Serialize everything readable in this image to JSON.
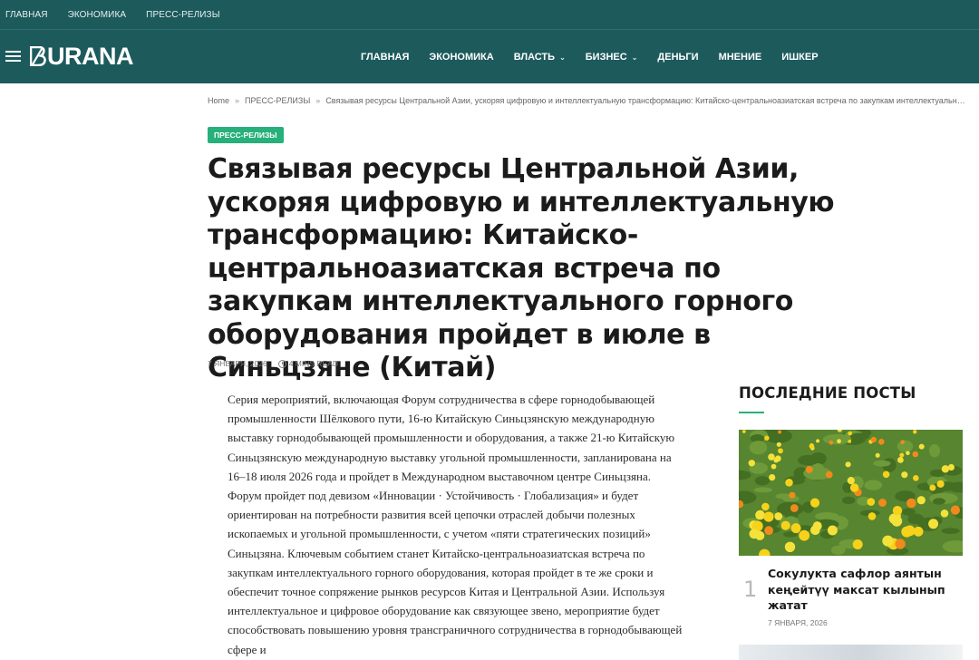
{
  "topbar": {
    "links": [
      "ГЛАВНАЯ",
      "ЭКОНОМИКА",
      "ПРЕСС-РЕЛИЗЫ"
    ]
  },
  "header": {
    "logo": "URANA",
    "nav": [
      {
        "label": "ГЛАВНАЯ",
        "dropdown": false
      },
      {
        "label": "ЭКОНОМИКА",
        "dropdown": false
      },
      {
        "label": "ВЛАСТЬ",
        "dropdown": true
      },
      {
        "label": "БИЗНЕС",
        "dropdown": true
      },
      {
        "label": "ДЕНЬГИ",
        "dropdown": false
      },
      {
        "label": "МНЕНИЕ",
        "dropdown": false
      },
      {
        "label": "ИШКЕР",
        "dropdown": false
      }
    ]
  },
  "breadcrumb": {
    "home": "Home",
    "separator": "»",
    "category": "ПРЕСС-РЕЛИЗЫ",
    "current": "Связывая ресурсы Центральной Азии, ускоряя цифровую и интеллектуальную трансформацию: Китайско-центральноазиатская встреча по закупкам интеллектуального горного …"
  },
  "article": {
    "category": "ПРЕСС-РЕЛИЗЫ",
    "title": "Связывая ресурсы Центральной Азии, ускоряя цифровую и интеллектуальную трансформацию: Китайско-центральноазиатская встреча по закупкам интеллектуального горного оборудования пройдет в июле в Синьцзяне (Китай)",
    "date": "7 ЯНВАРЯ, 2026",
    "read_time": "4 MINS READ",
    "body": "Серия мероприятий, включающая Форум сотрудничества в сфере горнодобывающей промышленности Шёлкового пути, 16-ю Китайскую Синьцзянскую международную выставку горнодобывающей промышленности и оборудования, а также 21-ю Китайскую Синьцзянскую международную выставку угольной промышленности, запланирована на 16–18 июля 2026 года и пройдет в Международном выставочном центре Синьцзяна. Форум пройдет под девизом «Инновации · Устойчивость · Глобализация» и будет ориентирован на потребности развития всей цепочки отраслей добычи полезных ископаемых и угольной промышленности, с учетом «пяти стратегических позиций» Синьцзяна. Ключевым событием станет Китайско-центральноазиатская встреча по закупкам интеллектуального горного оборудования, которая пройдет в те же сроки и обеспечит точное сопряжение рынков ресурсов Китая и Центральной Азии. Используя интеллектуальное и цифровое оборудование как связующее звено, мероприятие будет способствовать повышению уровня трансграничного сотрудничества в горнодобывающей сфере и"
  },
  "sidebar": {
    "heading": "ПОСЛЕДНИЕ ПОСТЫ",
    "posts": [
      {
        "number": "1",
        "title": "Сокулукта сафлор аянтын кеңейтүү максат кылынып жатат",
        "date": "7 ЯНВАРЯ, 2026"
      }
    ]
  },
  "colors": {
    "header_bg": "#1d5a5c",
    "accent": "#27b07a"
  }
}
